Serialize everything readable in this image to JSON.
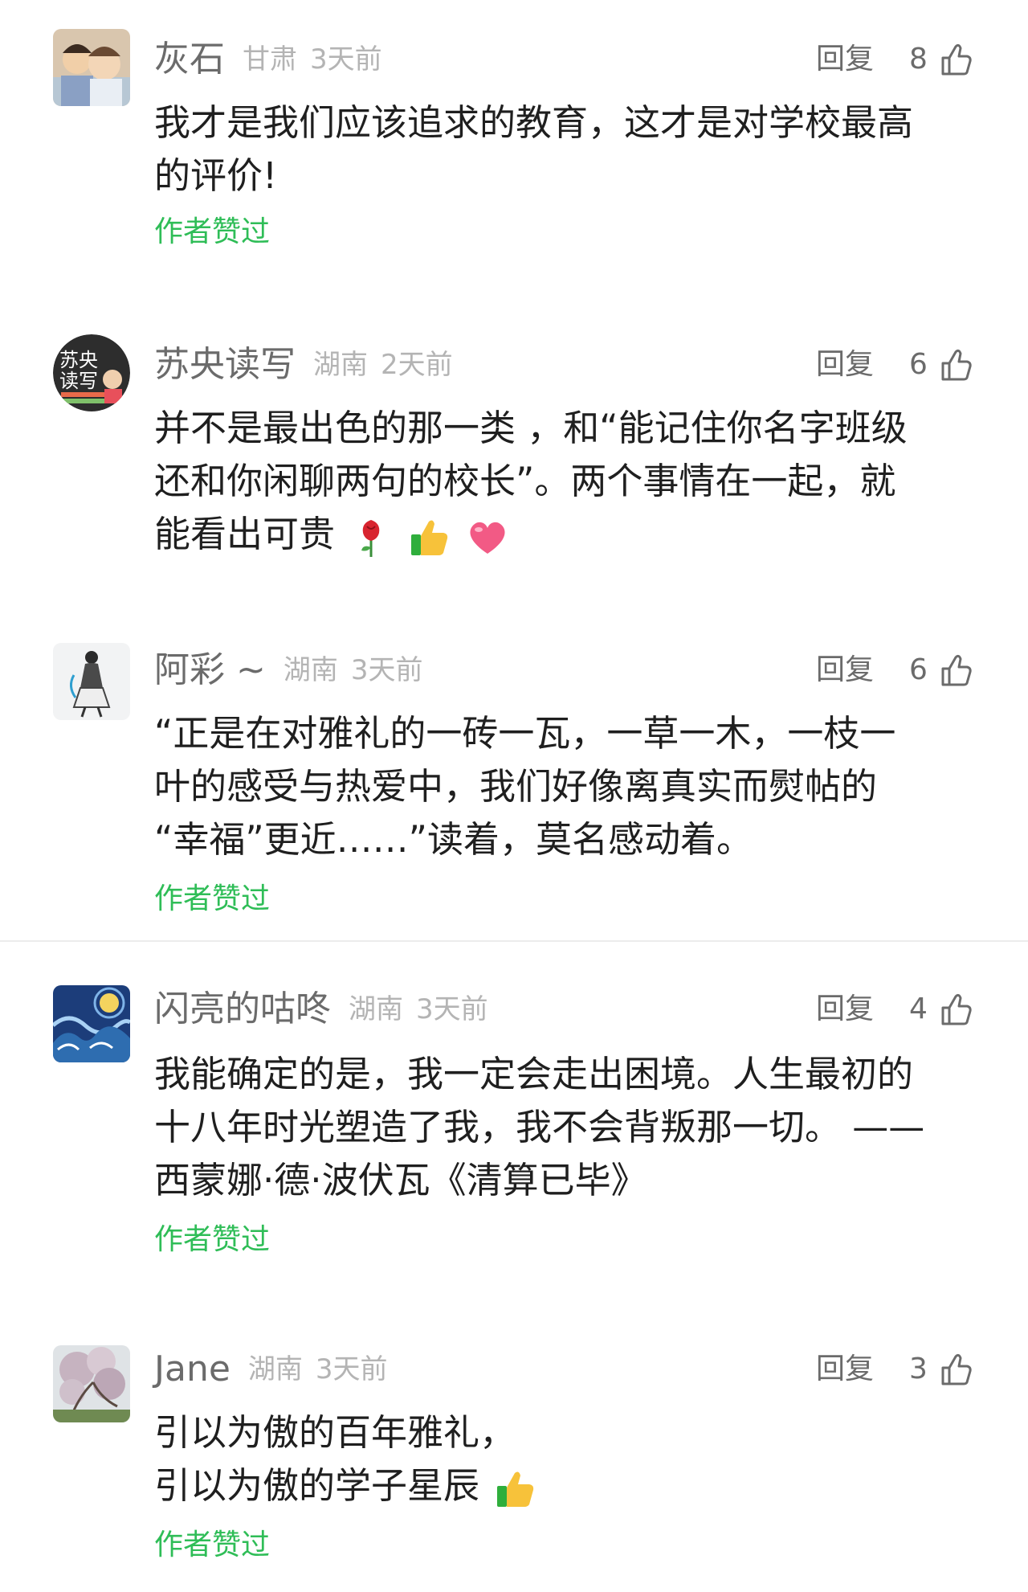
{
  "reply_label": "回复",
  "author_liked_label": "作者赞过",
  "accent_color": "#2fbd57",
  "comments": [
    {
      "nickname": "灰石",
      "location": "甘肃",
      "time": "3天前",
      "likes": "8",
      "lines": [
        "我才是我们应该追求的教育，这才是对学校最高",
        "的评价!"
      ]
    },
    {
      "nickname": "苏央读写",
      "location": "湖南",
      "time": "2天前",
      "likes": "6",
      "lines": [
        "并不是最出色的那一类 ，和“能记住你名字班级",
        "还和你闲聊两句的校长”。两个事情在一起，就",
        "能看出可贵"
      ],
      "emojis": [
        "rose-emoji",
        "thumbs-up-emoji",
        "heart-emoji"
      ],
      "avatar_text": [
        "苏央",
        "读写"
      ]
    },
    {
      "nickname": "阿彩 ~",
      "location": "湖南",
      "time": "3天前",
      "likes": "6",
      "lines": [
        "“正是在对雅礼的一砖一瓦，一草一木，一枝一",
        "叶的感受与热爱中，我们好像离真实而熨帖的",
        "“幸福”更近……”读着，莫名感动着。"
      ]
    },
    {
      "nickname": "闪亮的咕咚",
      "location": "湖南",
      "time": "3天前",
      "likes": "4",
      "lines": [
        "我能确定的是，我一定会走出困境。人生最初的",
        "十八年时光塑造了我，我不会背叛那一切。 ——",
        "西蒙娜·德·波伏瓦《清算已毕》"
      ]
    },
    {
      "nickname": "Jane",
      "location": "湖南",
      "time": "3天前",
      "likes": "3",
      "lines": [
        "引以为傲的百年雅礼，",
        "引以为傲的学子星辰"
      ],
      "emojis": [
        "thumbs-up-emoji"
      ]
    }
  ]
}
